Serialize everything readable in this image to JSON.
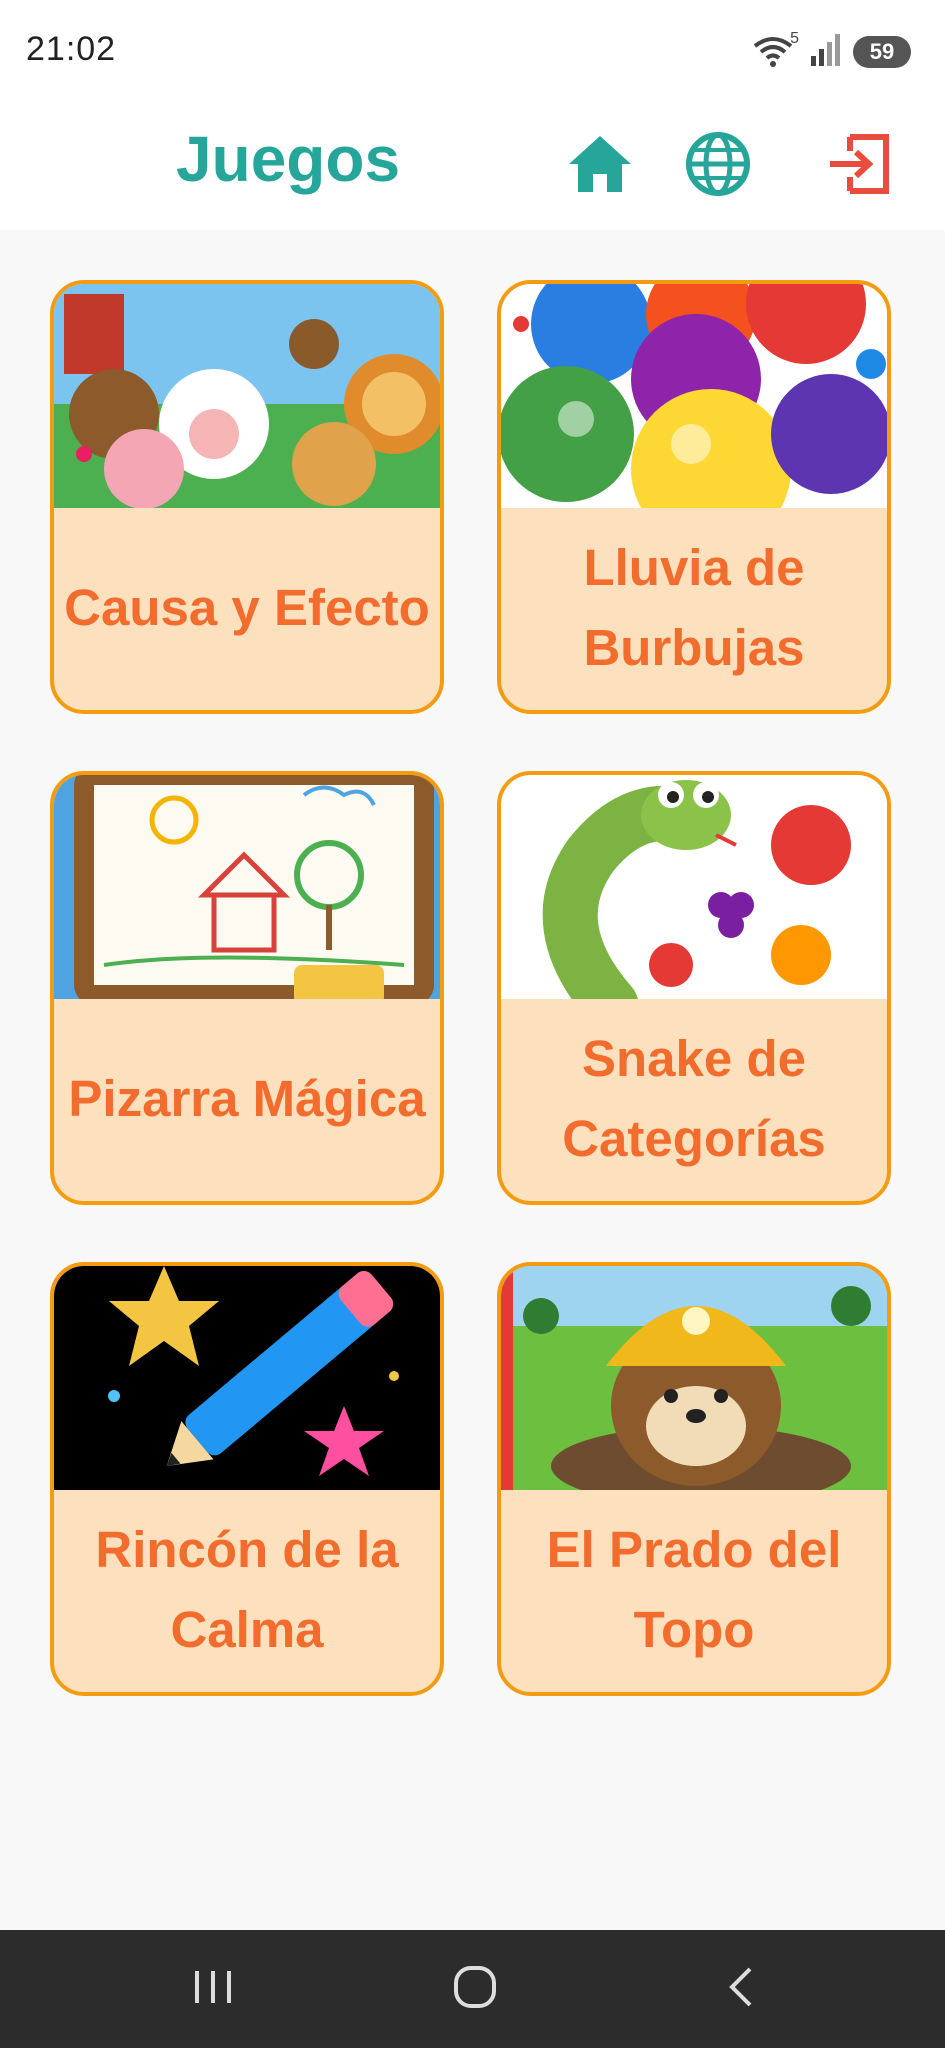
{
  "status": {
    "time": "21:02",
    "wifi_sub": "5",
    "battery": "59"
  },
  "header": {
    "title": "Juegos",
    "home_icon": "home-icon",
    "language_icon": "globe-icon",
    "logout_icon": "logout-icon",
    "accent": "#26a69a",
    "logout_color": "#e74c3c"
  },
  "games": [
    {
      "label": "Causa y Efecto",
      "image": "farm-animals-illustration"
    },
    {
      "label": "Lluvia de Burbujas",
      "image": "colorful-bubbles-illustration"
    },
    {
      "label": "Pizarra Mágica",
      "image": "drawing-board-illustration"
    },
    {
      "label": "Snake de Categorías",
      "image": "snake-and-fruits-illustration"
    },
    {
      "label": "Rincón de la Calma",
      "image": "pencil-and-stars-illustration"
    },
    {
      "label": "El Prado del Topo",
      "image": "mole-with-helmet-illustration"
    }
  ],
  "colors": {
    "card_border": "#f39c12",
    "card_bg": "#fde1be",
    "card_text": "#f26c2d"
  },
  "nav": {
    "recents_icon": "recents-icon",
    "home_icon": "circle-home-icon",
    "back_icon": "back-chevron-icon"
  }
}
